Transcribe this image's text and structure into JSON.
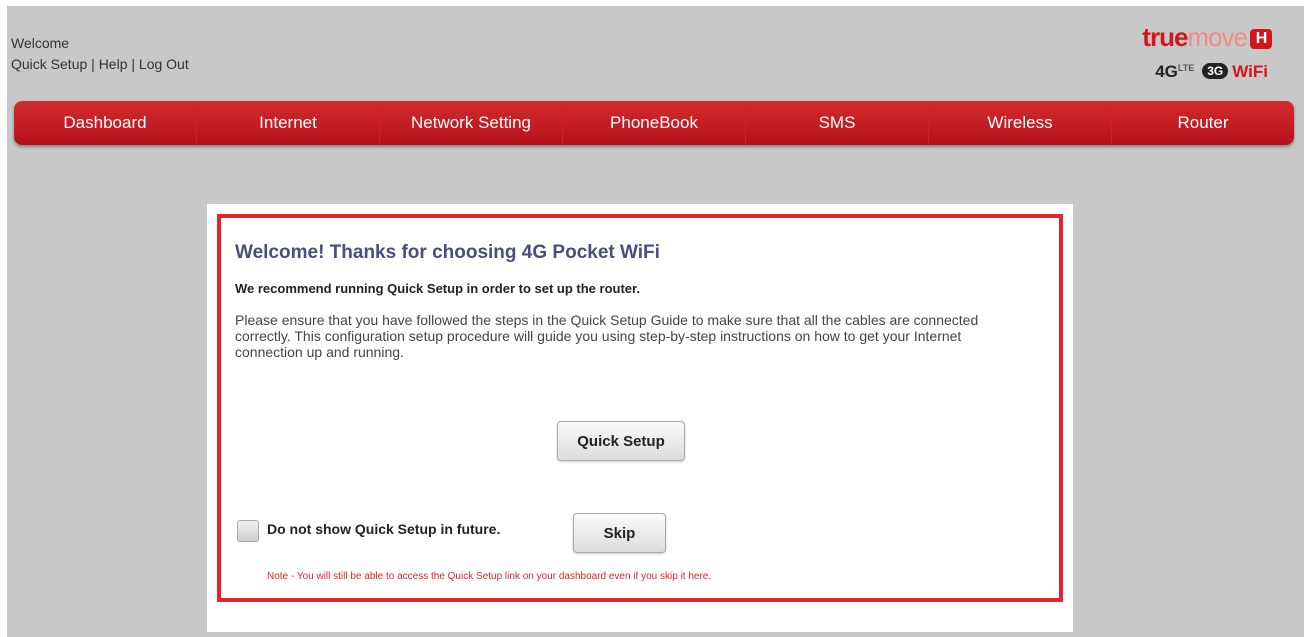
{
  "header": {
    "welcome": "Welcome",
    "links": [
      "Quick Setup",
      "Help",
      "Log Out"
    ],
    "separator": " | "
  },
  "logo": {
    "brand_true": "true",
    "brand_move": "move",
    "brand_h": "H",
    "tech_4g": "4G",
    "tech_lte": "LTE",
    "tech_3g": "3G",
    "tech_wifi": "WiFi"
  },
  "nav": {
    "items": [
      "Dashboard",
      "Internet",
      "Network Setting",
      "PhoneBook",
      "SMS",
      "Wireless",
      "Router"
    ]
  },
  "panel": {
    "title": "Welcome! Thanks for choosing 4G Pocket WiFi",
    "subtitle": "We recommend running Quick Setup in order to set up the router.",
    "description": "Please ensure that you have followed the steps in the Quick Setup Guide to make sure that all the cables are connected correctly. This configuration setup procedure will guide you using step-by-step instructions on how to get your Internet connection up and running.",
    "quick_setup_button": "Quick Setup",
    "checkbox_label": "Do not show Quick Setup in future.",
    "checkbox_checked": false,
    "skip_button": "Skip",
    "note": "Note - You will still be able to access the Quick Setup link on your dashboard even if you skip it here."
  },
  "colors": {
    "nav_red": "#c41a21",
    "frame_red": "#e2242f",
    "title_color": "#4a4e7c",
    "background": "#c8c8c8"
  }
}
